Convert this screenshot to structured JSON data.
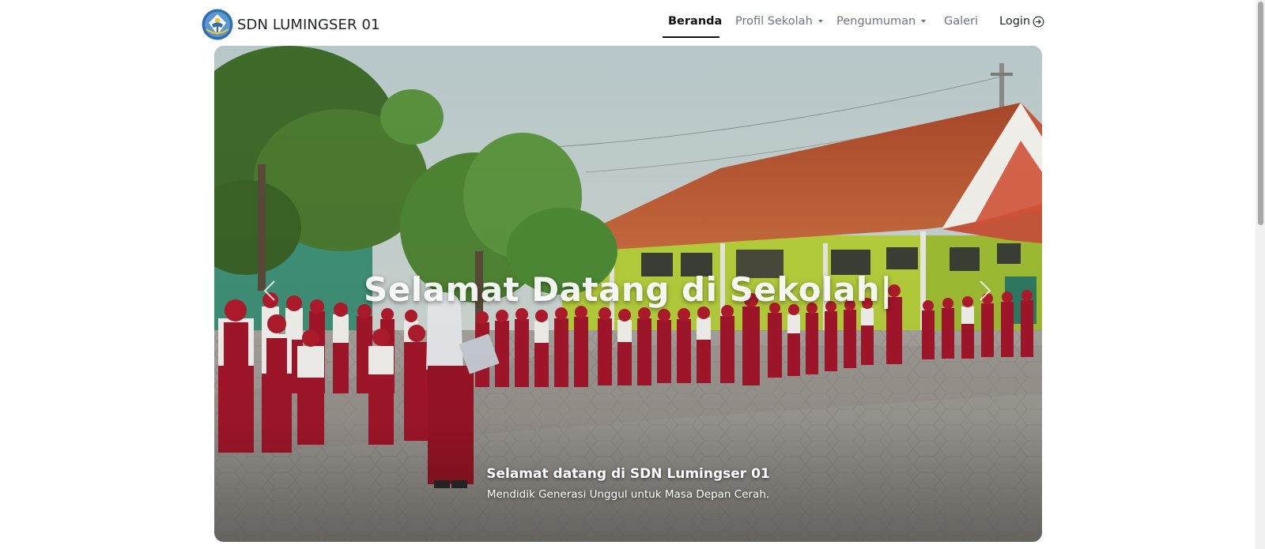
{
  "brand": {
    "name": "SDN LUMINGSER 01",
    "logo_icon": "tut-wuri-handayani-logo"
  },
  "nav": {
    "items": [
      {
        "label": "Beranda",
        "active": true
      },
      {
        "label": "Profil Sekolah",
        "dropdown": true
      },
      {
        "label": "Pengumuman",
        "dropdown": true
      },
      {
        "label": "Galeri"
      }
    ],
    "login": {
      "label": "Login",
      "icon": "arrow-right-circle-icon"
    }
  },
  "hero": {
    "headline": "Selamat Datang di Sekolah|",
    "caption_title": "Selamat datang di SDN Lumingser 01",
    "caption_subtitle": "Mendidik Generasi Unggul untuk Masa Depan Cerah.",
    "prev_icon": "chevron-left-icon",
    "next_icon": "chevron-right-icon"
  },
  "colors": {
    "text": "#212529",
    "nav_muted": "#6c757d",
    "active": "#111111",
    "uniform_red": "#a3162a",
    "building_wall": "#b7d23a",
    "roof": "#b8532c"
  }
}
